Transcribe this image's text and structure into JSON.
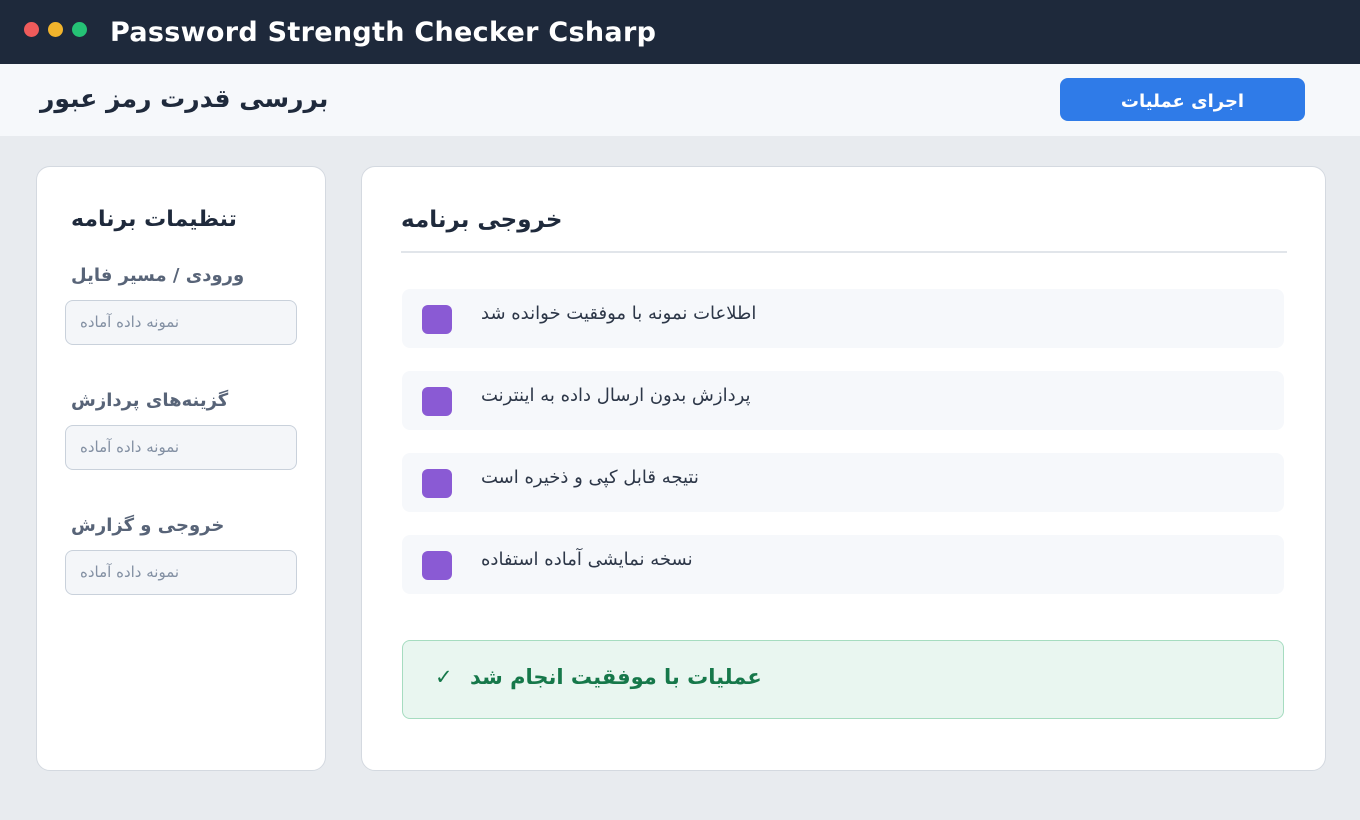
{
  "window": {
    "title": "Password Strength Checker Csharp",
    "controls": [
      "close",
      "minimize",
      "maximize"
    ]
  },
  "header": {
    "page_title": "بررسی قدرت رمز عبور",
    "run_button_label": "اجرای عملیات"
  },
  "sidebar": {
    "title": "تنظیمات برنامه",
    "fields": [
      {
        "label": "ورودی / مسیر فایل",
        "value": "نمونه داده آماده"
      },
      {
        "label": "گزینه‌های پردازش",
        "value": "نمونه داده آماده"
      },
      {
        "label": "خروجی و گزارش",
        "value": "نمونه داده آماده"
      }
    ]
  },
  "main": {
    "title": "خروجی برنامه",
    "items": [
      {
        "text": "اطلاعات نمونه با موفقیت خوانده شد",
        "icon": "square-icon"
      },
      {
        "text": "پردازش بدون ارسال داده به اینترنت",
        "icon": "square-icon"
      },
      {
        "text": "نتیجه قابل کپی و ذخیره است",
        "icon": "square-icon"
      },
      {
        "text": "نسخه نمایشی آماده استفاده",
        "icon": "square-icon"
      }
    ],
    "status": {
      "icon": "✓",
      "text": "عملیات با موفقیت انجام شد"
    }
  },
  "colors": {
    "titlebar": "#1e293b",
    "accent": "#2f7be8",
    "item_icon": "#8a5ad4",
    "success": "#16784a"
  }
}
